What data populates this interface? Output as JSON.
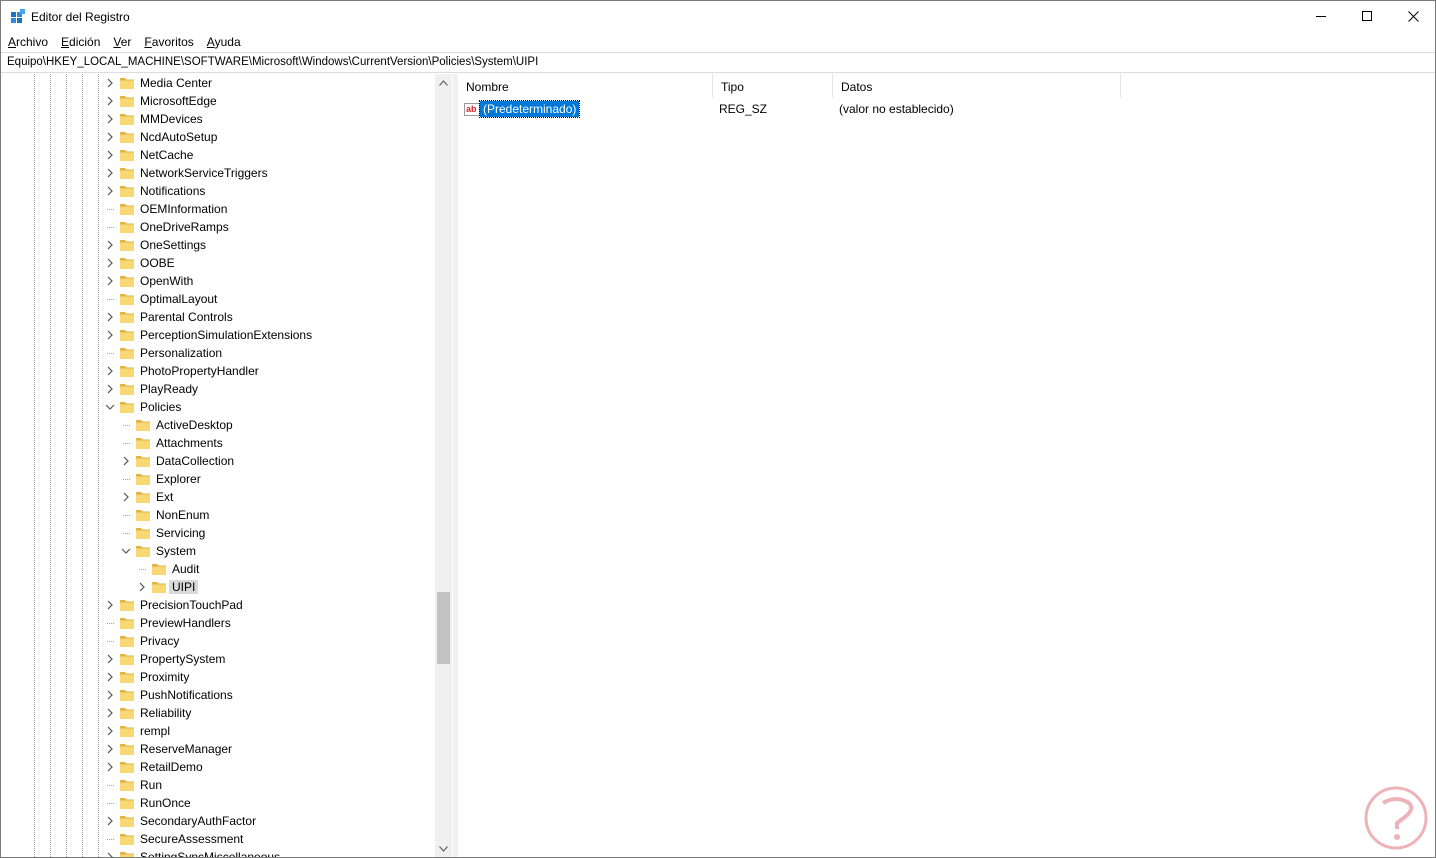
{
  "window": {
    "title": "Editor del Registro",
    "menu": [
      {
        "accel": "A",
        "rest": "rchivo"
      },
      {
        "accel": "E",
        "rest": "dición"
      },
      {
        "accel": "V",
        "rest": "er"
      },
      {
        "accel": "F",
        "rest": "avoritos"
      },
      {
        "accel": "A",
        "rest": "yuda"
      }
    ]
  },
  "address": "Equipo\\HKEY_LOCAL_MACHINE\\SOFTWARE\\Microsoft\\Windows\\CurrentVersion\\Policies\\System\\UIPI",
  "tree": [
    {
      "label": "Media Center",
      "depth": 0,
      "expander": "collapsed"
    },
    {
      "label": "MicrosoftEdge",
      "depth": 0,
      "expander": "collapsed"
    },
    {
      "label": "MMDevices",
      "depth": 0,
      "expander": "collapsed"
    },
    {
      "label": "NcdAutoSetup",
      "depth": 0,
      "expander": "collapsed"
    },
    {
      "label": "NetCache",
      "depth": 0,
      "expander": "collapsed"
    },
    {
      "label": "NetworkServiceTriggers",
      "depth": 0,
      "expander": "collapsed"
    },
    {
      "label": "Notifications",
      "depth": 0,
      "expander": "collapsed"
    },
    {
      "label": "OEMInformation",
      "depth": 0,
      "expander": "none"
    },
    {
      "label": "OneDriveRamps",
      "depth": 0,
      "expander": "none"
    },
    {
      "label": "OneSettings",
      "depth": 0,
      "expander": "collapsed"
    },
    {
      "label": "OOBE",
      "depth": 0,
      "expander": "collapsed"
    },
    {
      "label": "OpenWith",
      "depth": 0,
      "expander": "collapsed"
    },
    {
      "label": "OptimalLayout",
      "depth": 0,
      "expander": "none"
    },
    {
      "label": "Parental Controls",
      "depth": 0,
      "expander": "collapsed"
    },
    {
      "label": "PerceptionSimulationExtensions",
      "depth": 0,
      "expander": "collapsed"
    },
    {
      "label": "Personalization",
      "depth": 0,
      "expander": "none"
    },
    {
      "label": "PhotoPropertyHandler",
      "depth": 0,
      "expander": "collapsed"
    },
    {
      "label": "PlayReady",
      "depth": 0,
      "expander": "collapsed"
    },
    {
      "label": "Policies",
      "depth": 0,
      "expander": "expanded"
    },
    {
      "label": "ActiveDesktop",
      "depth": 1,
      "expander": "none"
    },
    {
      "label": "Attachments",
      "depth": 1,
      "expander": "none"
    },
    {
      "label": "DataCollection",
      "depth": 1,
      "expander": "collapsed"
    },
    {
      "label": "Explorer",
      "depth": 1,
      "expander": "none"
    },
    {
      "label": "Ext",
      "depth": 1,
      "expander": "collapsed"
    },
    {
      "label": "NonEnum",
      "depth": 1,
      "expander": "none"
    },
    {
      "label": "Servicing",
      "depth": 1,
      "expander": "none"
    },
    {
      "label": "System",
      "depth": 1,
      "expander": "expanded"
    },
    {
      "label": "Audit",
      "depth": 2,
      "expander": "none"
    },
    {
      "label": "UIPI",
      "depth": 2,
      "expander": "collapsed",
      "selected": true
    },
    {
      "label": "PrecisionTouchPad",
      "depth": 0,
      "expander": "collapsed"
    },
    {
      "label": "PreviewHandlers",
      "depth": 0,
      "expander": "none"
    },
    {
      "label": "Privacy",
      "depth": 0,
      "expander": "none"
    },
    {
      "label": "PropertySystem",
      "depth": 0,
      "expander": "collapsed"
    },
    {
      "label": "Proximity",
      "depth": 0,
      "expander": "collapsed"
    },
    {
      "label": "PushNotifications",
      "depth": 0,
      "expander": "collapsed"
    },
    {
      "label": "Reliability",
      "depth": 0,
      "expander": "collapsed"
    },
    {
      "label": "rempl",
      "depth": 0,
      "expander": "collapsed"
    },
    {
      "label": "ReserveManager",
      "depth": 0,
      "expander": "collapsed"
    },
    {
      "label": "RetailDemo",
      "depth": 0,
      "expander": "collapsed"
    },
    {
      "label": "Run",
      "depth": 0,
      "expander": "none"
    },
    {
      "label": "RunOnce",
      "depth": 0,
      "expander": "none"
    },
    {
      "label": "SecondaryAuthFactor",
      "depth": 0,
      "expander": "collapsed"
    },
    {
      "label": "SecureAssessment",
      "depth": 0,
      "expander": "none"
    },
    {
      "label": "SettingSyncMiscellaneous",
      "depth": 0,
      "expander": "collapsed"
    }
  ],
  "list": {
    "columns": [
      "Nombre",
      "Tipo",
      "Datos"
    ],
    "rows": [
      {
        "name": "(Predeterminado)",
        "type": "REG_SZ",
        "data": "(valor no establecido)",
        "icon": "string-value-icon",
        "selected": true
      }
    ]
  },
  "colors": {
    "folder": "#f8d775",
    "folder_dark": "#e3b341",
    "selection": "#0078d7",
    "tree_selected": "#d9d9d9",
    "watermark": "#e8a0a8"
  }
}
